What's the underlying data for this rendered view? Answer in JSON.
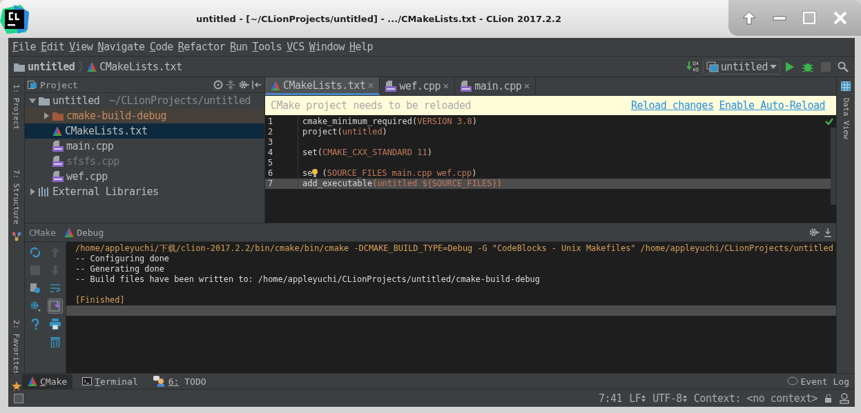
{
  "window": {
    "title": "untitled - [~/CLionProjects/untitled] - .../CMakeLists.txt - CLion 2017.2.2"
  },
  "menu": [
    "File",
    "Edit",
    "View",
    "Navigate",
    "Code",
    "Refactor",
    "Run",
    "Tools",
    "VCS",
    "Window",
    "Help"
  ],
  "breadcrumbs": [
    {
      "label": "untitled",
      "kind": "folder"
    },
    {
      "label": "CMakeLists.txt",
      "kind": "cmake"
    }
  ],
  "run_config": "untitled",
  "left_stripe": [
    {
      "label": "1: Project"
    },
    {
      "label": "7: Structure"
    },
    {
      "label": "2: Favorites"
    }
  ],
  "right_stripe": [
    {
      "label": "Data View"
    }
  ],
  "project_panel": {
    "title": "Project",
    "tree": [
      {
        "label": "untitled",
        "path": "~/CLionProjects/untitled",
        "kind": "folder",
        "expanded": true,
        "selected": false,
        "greyed": false,
        "children": [
          {
            "label": "cmake-build-debug",
            "kind": "excluded-folder",
            "expanded": false,
            "selected": false,
            "greyed": false
          },
          {
            "label": "CMakeLists.txt",
            "kind": "cmake",
            "selected": true,
            "greyed": false
          },
          {
            "label": "main.cpp",
            "kind": "cpp",
            "selected": false,
            "greyed": false
          },
          {
            "label": "sfsfs.cpp",
            "kind": "cpp",
            "selected": false,
            "greyed": true
          },
          {
            "label": "wef.cpp",
            "kind": "cpp",
            "selected": false,
            "greyed": false
          }
        ]
      },
      {
        "label": "External Libraries",
        "kind": "library",
        "expanded": false,
        "selected": false,
        "greyed": false
      }
    ]
  },
  "editor": {
    "tabs": [
      {
        "label": "CMakeLists.txt",
        "kind": "cmake",
        "selected": true
      },
      {
        "label": "wef.cpp",
        "kind": "cpp",
        "selected": false
      },
      {
        "label": "main.cpp",
        "kind": "cpp",
        "selected": false
      }
    ],
    "notification": {
      "message": "CMake project needs to be reloaded",
      "links": [
        "Reload changes",
        "Enable Auto-Reload"
      ]
    },
    "lines": [
      {
        "number": "1",
        "current": false,
        "segments": [
          {
            "text": "cmake_minimum_required",
            "kind": "command"
          },
          {
            "text": "(",
            "kind": "paren"
          },
          {
            "text": "VERSION 3.8",
            "kind": "arg"
          },
          {
            "text": ")",
            "kind": "paren"
          }
        ]
      },
      {
        "number": "2",
        "current": false,
        "segments": [
          {
            "text": "project",
            "kind": "command"
          },
          {
            "text": "(",
            "kind": "paren"
          },
          {
            "text": "untitled",
            "kind": "arg"
          },
          {
            "text": ")",
            "kind": "paren"
          }
        ]
      },
      {
        "number": "3",
        "current": false
      },
      {
        "number": "4",
        "current": false,
        "segments": [
          {
            "text": "set",
            "kind": "command"
          },
          {
            "text": "(",
            "kind": "paren"
          },
          {
            "text": "CMAKE_CXX_STANDARD 11",
            "kind": "arg"
          },
          {
            "text": ")",
            "kind": "paren"
          }
        ]
      },
      {
        "number": "5",
        "current": false
      },
      {
        "number": "6",
        "current": false,
        "segments": [
          {
            "text": "se",
            "kind": "command"
          },
          {
            "kind": "bulb"
          },
          {
            "text": "(",
            "kind": "paren"
          },
          {
            "text": "SOURCE_FILES main.cpp wef.cpp",
            "kind": "arg"
          },
          {
            "text": ")",
            "kind": "paren"
          }
        ]
      },
      {
        "number": "7",
        "current": true,
        "segments": [
          {
            "text": "add_executable",
            "kind": "command"
          },
          {
            "text": "(",
            "kind": "brace"
          },
          {
            "text": "untitled ${SOURCE_FILES}",
            "kind": "arg"
          },
          {
            "text": ")",
            "kind": "brace"
          }
        ]
      }
    ]
  },
  "tool_window": {
    "title": "CMake",
    "tabs": [
      {
        "label": "Debug",
        "kind": "cmake"
      }
    ],
    "console": [
      {
        "text": "/home/appleyuchi/下载/clion-2017.2.2/bin/cmake/bin/cmake -DCMAKE_BUILD_TYPE=Debug -G \"CodeBlocks - Unix Makefiles\" /home/appleyuchi/CLionProjects/untitled",
        "kind": "command"
      },
      {
        "text": "-- Configuring done",
        "kind": "output"
      },
      {
        "text": "-- Generating done",
        "kind": "output"
      },
      {
        "text": "-- Build files have been written to: /home/appleyuchi/CLionProjects/untitled/cmake-build-debug",
        "kind": "output"
      },
      {
        "text": "[Finished]",
        "kind": "status"
      }
    ]
  },
  "tool_tabs": [
    {
      "label": "CMake",
      "kind": "cmake",
      "selected": true
    },
    {
      "label": "Terminal",
      "kind": "terminal",
      "selected": false
    },
    {
      "label": "6: TODO",
      "kind": "todo",
      "selected": false
    }
  ],
  "event_log": "Event Log",
  "status_bar": {
    "position": "7:41",
    "line_separator": "LF",
    "encoding": "UTF-8",
    "context": "Context: <no context>"
  }
}
